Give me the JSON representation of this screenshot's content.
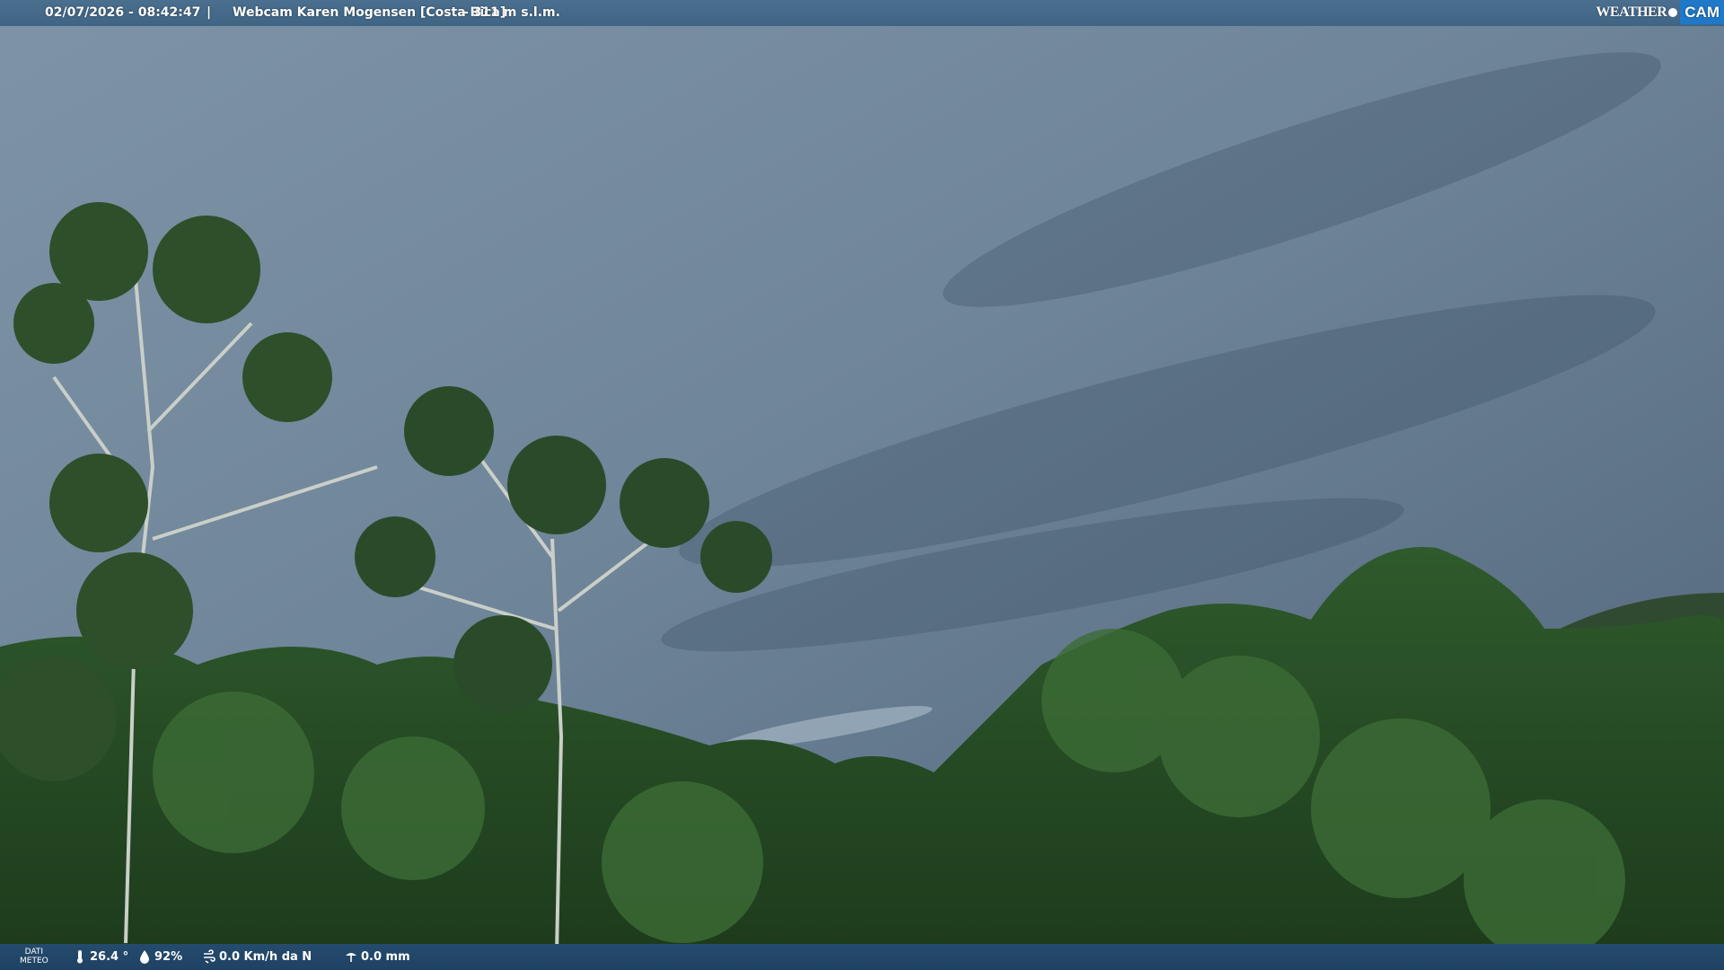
{
  "header": {
    "timestamp": "02/07/2026 - 08:42:47",
    "separator": "|",
    "title": "Webcam Karen Mogensen [Costa Rica]",
    "altitude": "- 311 m s.l.m."
  },
  "logo": {
    "word_left": "WEATHER",
    "word_right": "CAM",
    "accent_color": "#1f78c8"
  },
  "weather": {
    "label_line1": "DATI",
    "label_line2": "METEO",
    "temperature": "26.4 °",
    "humidity": "92%",
    "wind": "0.0 Km/h da N",
    "rain": "0.0 mm"
  },
  "icons": {
    "temperature": "thermometer-icon",
    "humidity": "humidity-drop-icon",
    "wind": "wind-icon",
    "rain": "rain-gauge-icon"
  }
}
